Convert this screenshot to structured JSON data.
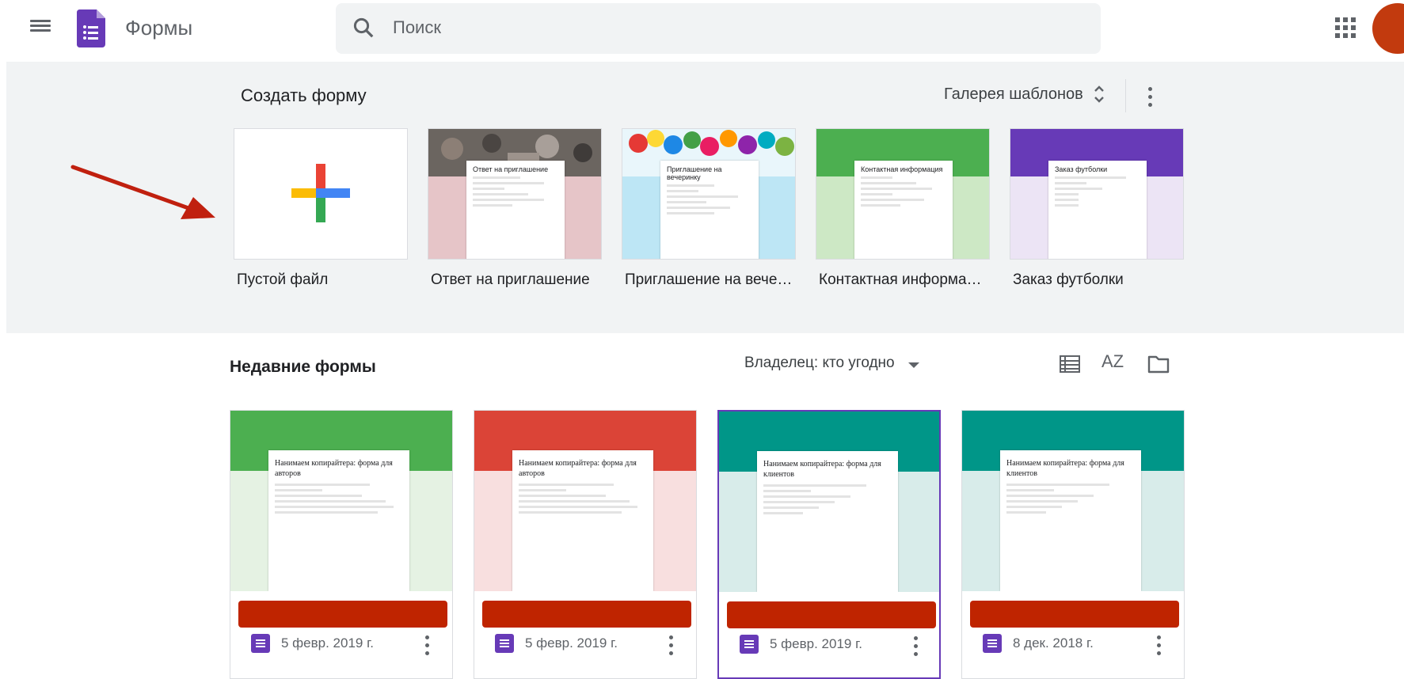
{
  "header": {
    "app_name": "Формы",
    "search_placeholder": "Поиск"
  },
  "templates": {
    "title": "Создать форму",
    "gallery_label": "Галерея шаблонов",
    "items": [
      {
        "label": "Пустой файл"
      },
      {
        "label": "Ответ на приглашение",
        "card_title": "Ответ на приглашение",
        "bg": "#e6c5c8"
      },
      {
        "label": "Приглашение на вече…",
        "card_title": "Приглашение на вечеринку",
        "bg": "#bde6f5"
      },
      {
        "label": "Контактная информа…",
        "card_title": "Контактная информация",
        "bg": "#cde8c5",
        "band": "#4caf50"
      },
      {
        "label": "Заказ футболки",
        "card_title": "Заказ футболки",
        "bg": "#ece4f5",
        "band": "#673ab7"
      }
    ]
  },
  "recent": {
    "title": "Недавние формы",
    "owner_filter": "Владелец: кто угодно",
    "sort_label": "AZ",
    "docs": [
      {
        "thumb_title": "Нанимаем копирайтера: форма для авторов",
        "date": "5 февр. 2019 г.",
        "band": "#4caf50",
        "bg": "#e5f2e3"
      },
      {
        "thumb_title": "Нанимаем копирайтера: форма для авторов",
        "date": "5 февр. 2019 г.",
        "band": "#db4437",
        "bg": "#f8dfdf"
      },
      {
        "thumb_title": "Нанимаем копирайтера: форма для клиентов",
        "date": "5 февр. 2019 г.",
        "band": "#009688",
        "bg": "#d8ecea"
      },
      {
        "thumb_title": "Нанимаем копирайтера: форма для клиентов",
        "date": "8 дек. 2018 г.",
        "band": "#009688",
        "bg": "#d8ecea"
      }
    ]
  }
}
